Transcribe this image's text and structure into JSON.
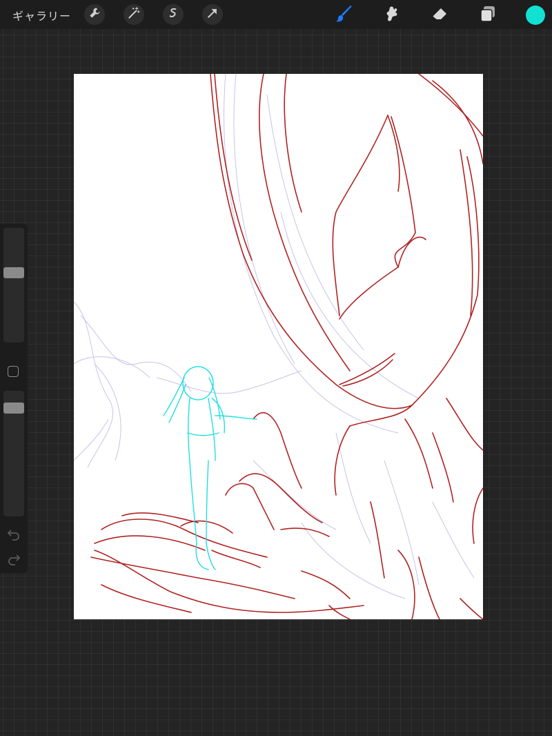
{
  "topbar": {
    "gallery_label": "ギャラリー",
    "actions": [
      {
        "icon": "wrench-icon"
      },
      {
        "icon": "magic-wand-icon"
      },
      {
        "icon": "selection-icon"
      },
      {
        "icon": "transform-arrow-icon"
      }
    ],
    "tools": [
      {
        "icon": "brush-icon",
        "active": true,
        "color": "#1e7bff"
      },
      {
        "icon": "smudge-icon",
        "active": false
      },
      {
        "icon": "eraser-icon",
        "active": false
      },
      {
        "icon": "layers-icon",
        "active": false
      }
    ],
    "current_color": "#12e0d2"
  },
  "sidebar": {
    "brush_size": 0.62,
    "opacity": 0.9
  },
  "canvas": {
    "background": "#ffffff",
    "stroke_colors": {
      "red": "#b02020",
      "cyan": "#1ee0e0",
      "lavender": "#b8b4e0"
    }
  }
}
